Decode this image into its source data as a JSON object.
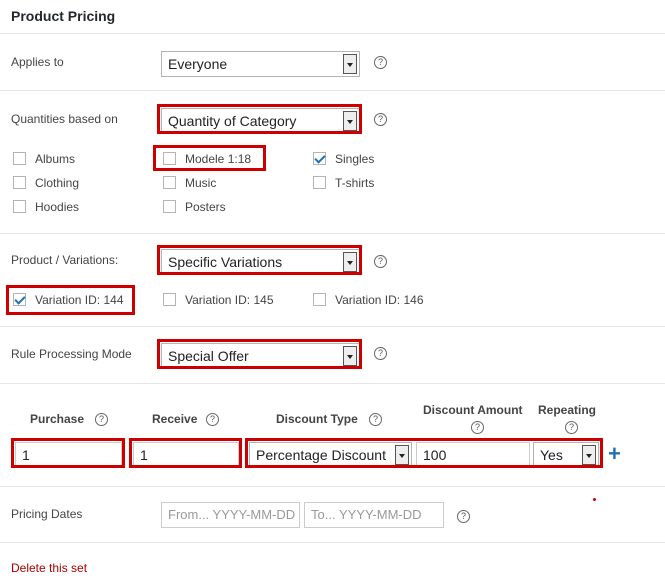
{
  "title": "Product Pricing",
  "applies_to": {
    "label": "Applies to",
    "value": "Everyone"
  },
  "quantities": {
    "label": "Quantities based on",
    "value": "Quantity of Category",
    "categories": [
      {
        "label": "Albums",
        "checked": false
      },
      {
        "label": "Modele 1:18",
        "checked": false
      },
      {
        "label": "Singles",
        "checked": true
      },
      {
        "label": "Clothing",
        "checked": false
      },
      {
        "label": "Music",
        "checked": false
      },
      {
        "label": "T-shirts",
        "checked": false
      },
      {
        "label": "Hoodies",
        "checked": false
      },
      {
        "label": "Posters",
        "checked": false
      }
    ]
  },
  "variations": {
    "label": "Product / Variations:",
    "value": "Specific Variations",
    "items": [
      {
        "label": "Variation ID: 144",
        "checked": true
      },
      {
        "label": "Variation ID: 145",
        "checked": false
      },
      {
        "label": "Variation ID: 146",
        "checked": false
      }
    ]
  },
  "processing": {
    "label": "Rule Processing Mode",
    "value": "Special Offer"
  },
  "table": {
    "headers": {
      "purchase": "Purchase",
      "receive": "Receive",
      "discount_type": "Discount Type",
      "discount_amount": "Discount Amount",
      "repeating": "Repeating"
    },
    "row": {
      "purchase": "1",
      "receive": "1",
      "discount_type": "Percentage Discount",
      "discount_amount": "100",
      "repeating": "Yes"
    },
    "add_icon": "+"
  },
  "dates": {
    "label": "Pricing Dates",
    "from_placeholder": "From... YYYY-MM-DD",
    "to_placeholder": "To... YYYY-MM-DD"
  },
  "help_glyph": "?",
  "delete_label": "Delete this set",
  "colors": {
    "highlight": "#cc0000",
    "link": "#aa0000",
    "accent": "#2271b1"
  }
}
